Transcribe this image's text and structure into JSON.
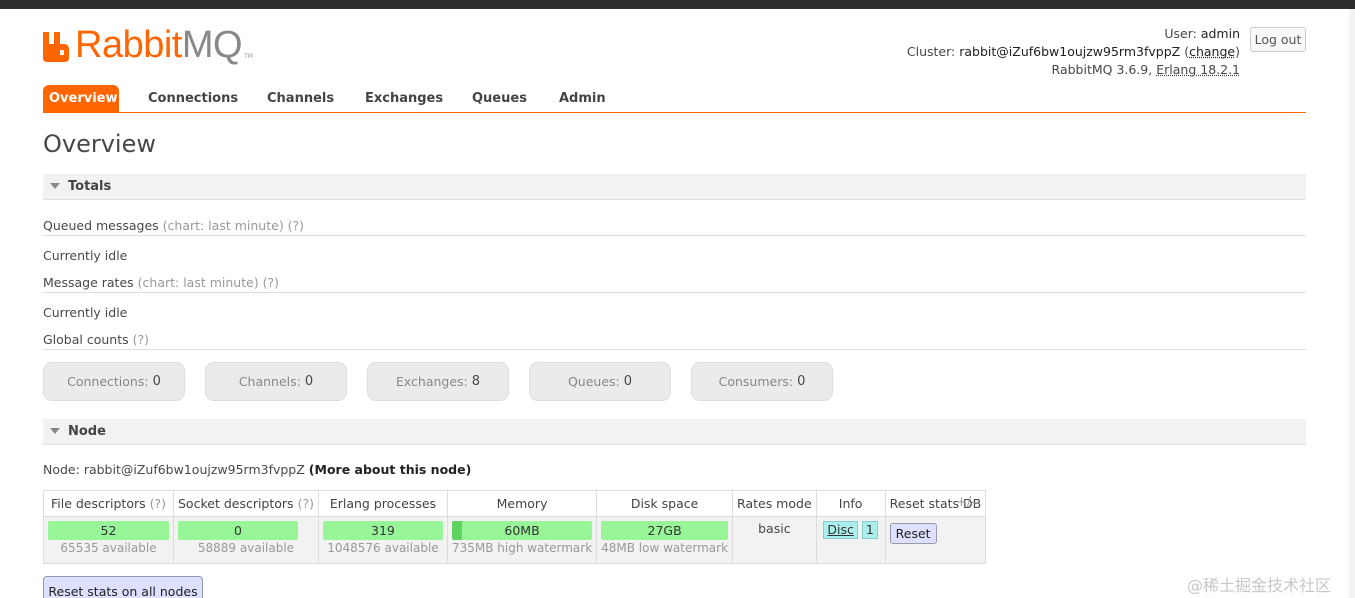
{
  "header": {
    "logo": {
      "brand_rabbit": "Rabbit",
      "brand_mq": "MQ",
      "tm": "TM"
    },
    "login": {
      "user_label": "User:",
      "user_value": "admin",
      "cluster_label": "Cluster:",
      "cluster_value": "rabbit@iZuf6bw1oujzw95rm3fvppZ",
      "change_open": "(",
      "change_link": "change",
      "change_close": ")",
      "version_text": "RabbitMQ 3.6.9,",
      "erlang_text": "Erlang 18.2.1"
    },
    "logout_label": "Log out"
  },
  "tabs": [
    {
      "label": "Overview",
      "active": true
    },
    {
      "label": "Connections",
      "active": false
    },
    {
      "label": "Channels",
      "active": false
    },
    {
      "label": "Exchanges",
      "active": false
    },
    {
      "label": "Queues",
      "active": false
    },
    {
      "label": "Admin",
      "active": false
    }
  ],
  "page_title": "Overview",
  "totals": {
    "heading": "Totals",
    "queued_messages": {
      "label": "Queued messages",
      "hint": "(chart: last minute) (?)",
      "status": "Currently idle"
    },
    "message_rates": {
      "label": "Message rates",
      "hint": "(chart: last minute) (?)",
      "status": "Currently idle"
    },
    "global_counts": {
      "label": "Global counts",
      "hint": "(?)"
    },
    "counts": [
      {
        "label": "Connections:",
        "value": "0"
      },
      {
        "label": "Channels:",
        "value": "0"
      },
      {
        "label": "Exchanges:",
        "value": "8"
      },
      {
        "label": "Queues:",
        "value": "0"
      },
      {
        "label": "Consumers:",
        "value": "0"
      }
    ]
  },
  "node": {
    "heading": "Node",
    "node_label": "Node:",
    "node_name": "rabbit@iZuf6bw1oujzw95rm3fvppZ",
    "more_link": "(More about this node)",
    "columns": {
      "file_descriptors": "File descriptors",
      "socket_descriptors": "Socket descriptors",
      "erlang_processes": "Erlang processes",
      "memory": "Memory",
      "disk_space": "Disk space",
      "rates_mode": "Rates mode",
      "info": "Info",
      "reset_stats_db": "Reset stats DB",
      "hint": "(?)",
      "plusminus": "+/-"
    },
    "row": {
      "file_descriptors": {
        "value": "52",
        "sub": "65535 available"
      },
      "socket_descriptors": {
        "value": "0",
        "sub": "58889 available"
      },
      "erlang_processes": {
        "value": "319",
        "sub": "1048576 available"
      },
      "memory": {
        "value": "60MB",
        "sub": "735MB high watermark"
      },
      "disk_space": {
        "value": "27GB",
        "sub": "48MB low watermark"
      },
      "rates_mode": "basic",
      "info_disc": "Disc",
      "info_count": "1",
      "reset_label": "Reset"
    },
    "reset_all_label": "Reset stats on all nodes"
  },
  "watermark": "@稀土掘金技术社区"
}
